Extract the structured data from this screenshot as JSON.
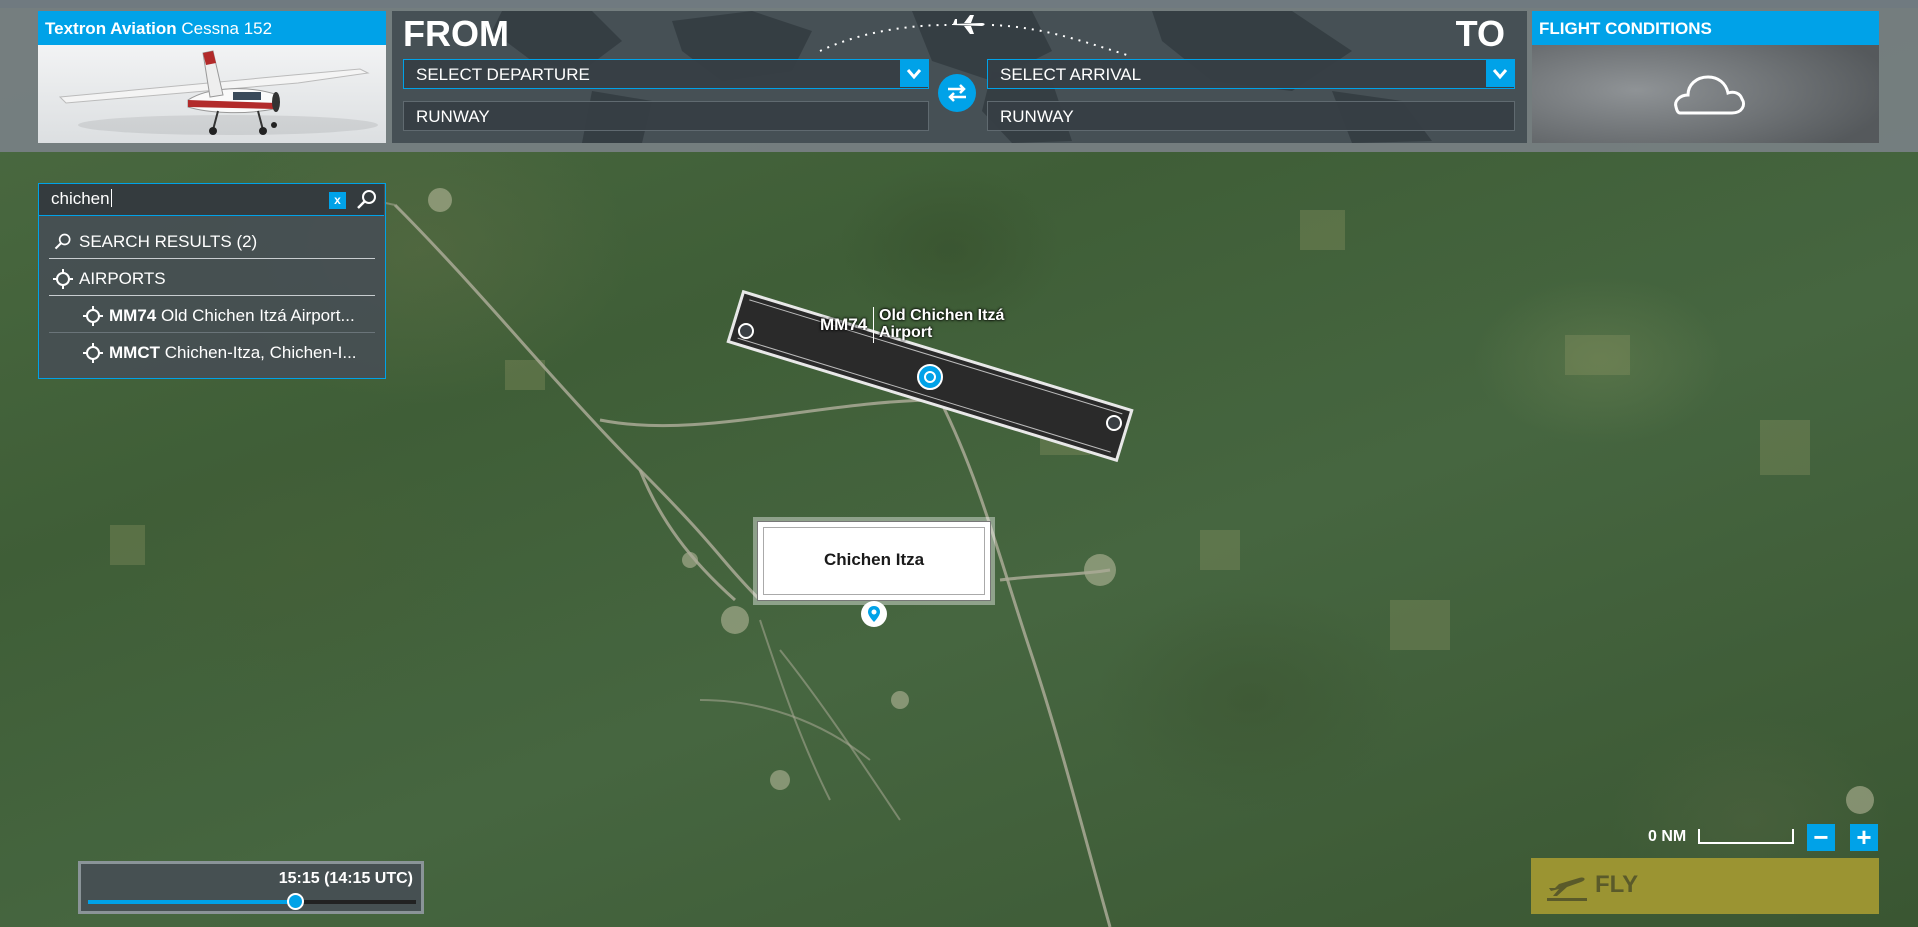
{
  "aircraft": {
    "maker": "Textron Aviation",
    "model": "Cessna 152"
  },
  "route": {
    "from_label": "FROM",
    "to_label": "TO",
    "departure_placeholder": "SELECT DEPARTURE",
    "arrival_placeholder": "SELECT ARRIVAL",
    "departure_runway": "RUNWAY",
    "arrival_runway": "RUNWAY"
  },
  "conditions": {
    "title": "FLIGHT CONDITIONS",
    "weather_icon": "cloud-icon"
  },
  "search": {
    "query": "chichen",
    "clear_label": "x",
    "results_header": "SEARCH RESULTS (2)",
    "category": "AIRPORTS",
    "results": [
      {
        "code": "MM74",
        "name": "Old Chichen Itzá Airport..."
      },
      {
        "code": "MMCT",
        "name": "Chichen-Itza, Chichen-I..."
      }
    ]
  },
  "map": {
    "runway_code": "MM74",
    "runway_name_line1": "Old Chichen Itzá",
    "runway_name_line2": "Airport",
    "poi_label": "Chichen Itza",
    "scale_label": "0 NM",
    "zoom_out_label": "−",
    "zoom_in_label": "+"
  },
  "time": {
    "display": "15:15 (14:15 UTC)",
    "slider_fraction": 0.63
  },
  "fly": {
    "label": "FLY"
  },
  "colors": {
    "accent": "#00a2e8",
    "fly": "#9b9432"
  }
}
